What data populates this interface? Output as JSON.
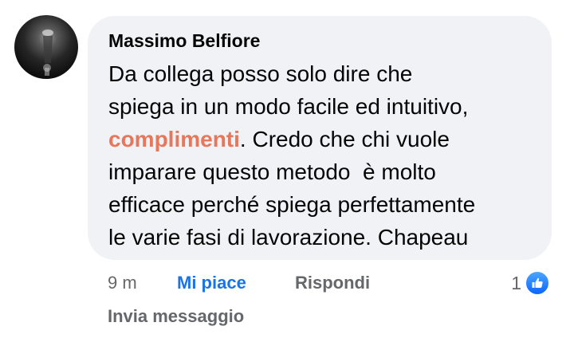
{
  "comment": {
    "author": "Massimo Belfiore",
    "text_lines": [
      {
        "before": "Da collega posso solo dire che",
        "highlight": "",
        "after": ""
      },
      {
        "before": "spiega in un modo facile ed intuitivo,",
        "highlight": "",
        "after": ""
      },
      {
        "before": "",
        "highlight": "complimenti",
        "after": ". Credo che chi vuole"
      },
      {
        "before": "imparare questo metodo  è molto",
        "highlight": "",
        "after": ""
      },
      {
        "before": "efficace perché spiega perfettamente",
        "highlight": "",
        "after": ""
      },
      {
        "before": "le varie fasi di lavorazione. Chapeau",
        "highlight": "",
        "after": ""
      }
    ],
    "highlight_color": "#e8765a",
    "bubble_color": "#f0f2f5"
  },
  "actions": {
    "time": "9 m",
    "like_label": "Mi piace",
    "reply_label": "Rispondi",
    "send_message_label": "Invia messaggio",
    "like_color": "#1b74e4"
  },
  "reactions": {
    "count": "1",
    "icon": "thumbs-up-icon"
  },
  "avatar": {
    "icon": "profile-photo"
  }
}
